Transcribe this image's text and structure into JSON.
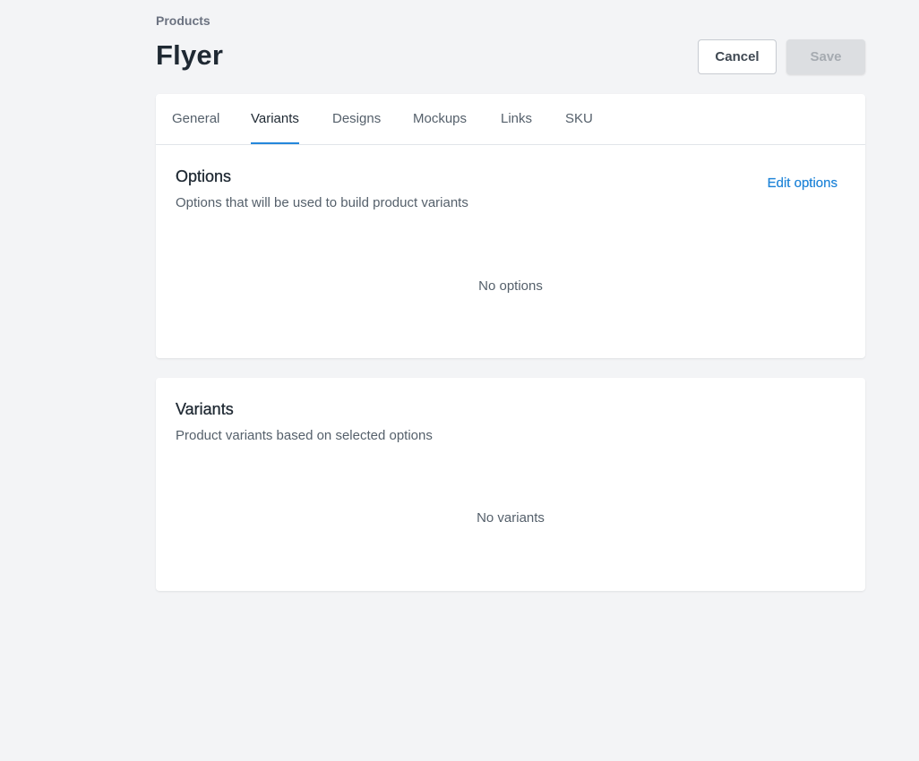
{
  "breadcrumb": "Products",
  "page_title": "Flyer",
  "actions": {
    "cancel_label": "Cancel",
    "save_label": "Save"
  },
  "tabs": [
    {
      "label": "General",
      "active": false
    },
    {
      "label": "Variants",
      "active": true
    },
    {
      "label": "Designs",
      "active": false
    },
    {
      "label": "Mockups",
      "active": false
    },
    {
      "label": "Links",
      "active": false
    },
    {
      "label": "SKU",
      "active": false
    }
  ],
  "options_section": {
    "title": "Options",
    "subtitle": "Options that will be used to build product variants",
    "edit_link": "Edit options",
    "empty_text": "No options"
  },
  "variants_section": {
    "title": "Variants",
    "subtitle": "Product variants based on selected options",
    "empty_text": "No variants"
  },
  "colors": {
    "background": "#f3f4f6",
    "accent": "#2487db",
    "link": "#1f84d8",
    "disabled_button": "#dcdee1"
  }
}
